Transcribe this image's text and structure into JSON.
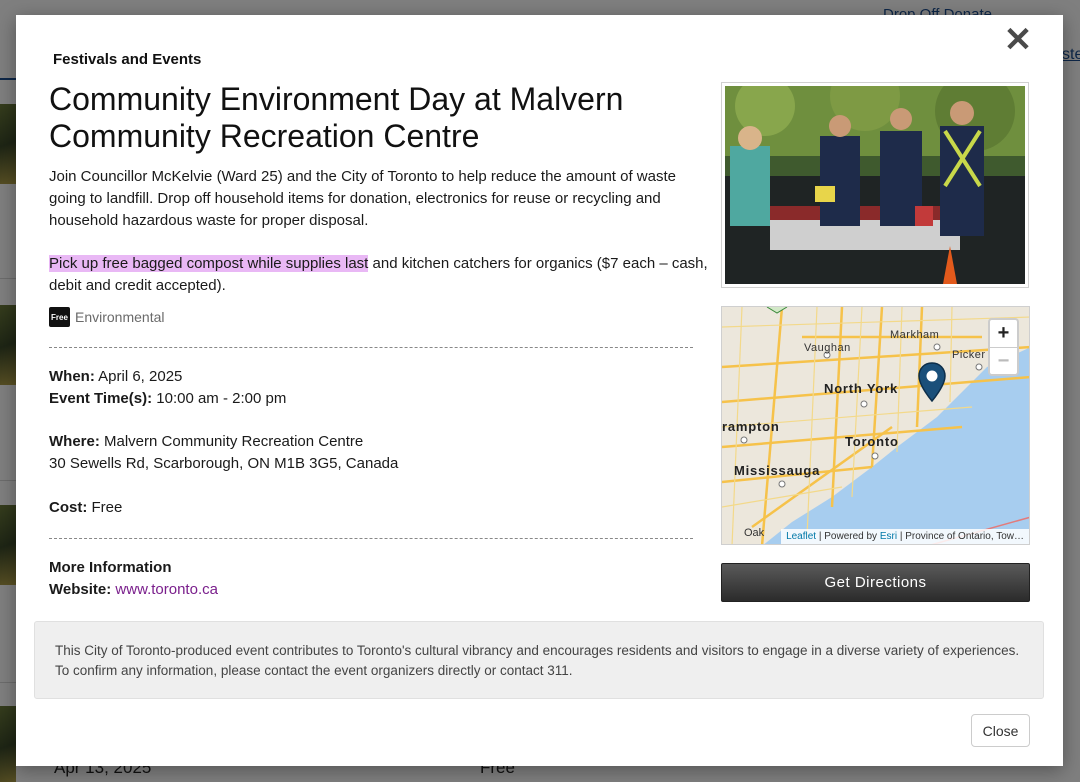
{
  "background": {
    "top_link": "Drop Off Donate",
    "right_link": "ste",
    "row_date": "Apr 13, 2025",
    "row_cost": "Free"
  },
  "modal": {
    "close_symbol": "✕",
    "category": "Festivals and Events",
    "title": "Community Environment Day at Malvern Community Recreation Centre",
    "description": "Join Councillor McKelvie (Ward 25) and the City of Toronto to help reduce the amount of waste going to landfill. Drop off household items for donation, electronics for reuse or recycling and household hazardous waste for proper disposal.",
    "description2_highlight": "Pick up free bagged compost while supplies last",
    "description2_rest": " and kitchen catchers for organics ($7 each – cash, debit and credit accepted).",
    "tag_badge": "Free",
    "tag_label": "Environmental",
    "when_label": "When:",
    "when_value": " April 6, 2025",
    "time_label": "Event Time(s):",
    "time_value": " 10:00 am - 2:00 pm",
    "where_label": "Where:",
    "where_value": " Malvern Community Recreation Centre",
    "address": "30 Sewells Rd, Scarborough, ON M1B 3G5, Canada",
    "cost_label": "Cost:",
    "cost_value": " Free",
    "more_info_heading": "More Information",
    "website_label": "Website:",
    "website_value": "www.toronto.ca",
    "directions_button": "Get Directions",
    "notice": "This City of Toronto-produced event contributes to Toronto's cultural vibrancy and encourages residents and visitors to engage in a diverse variety of experiences. To confirm any information, please contact the event organizers directly or contact 311.",
    "close_button": "Close"
  },
  "map": {
    "zoom_in": "+",
    "zoom_out": "−",
    "labels": {
      "markham": "Markham",
      "vaughan": "Vaughan",
      "pickering": "Picker",
      "north_york": "North York",
      "brampton": "rampton",
      "toronto": "Toronto",
      "mississauga": "Mississauga",
      "oakville": "Oak"
    },
    "attribution_leaflet": "Leaflet",
    "attribution_mid": " | Powered by ",
    "attribution_esri": "Esri",
    "attribution_rest": " | Province of Ontario, Tow…",
    "marker_color": "#1a4f7a"
  }
}
